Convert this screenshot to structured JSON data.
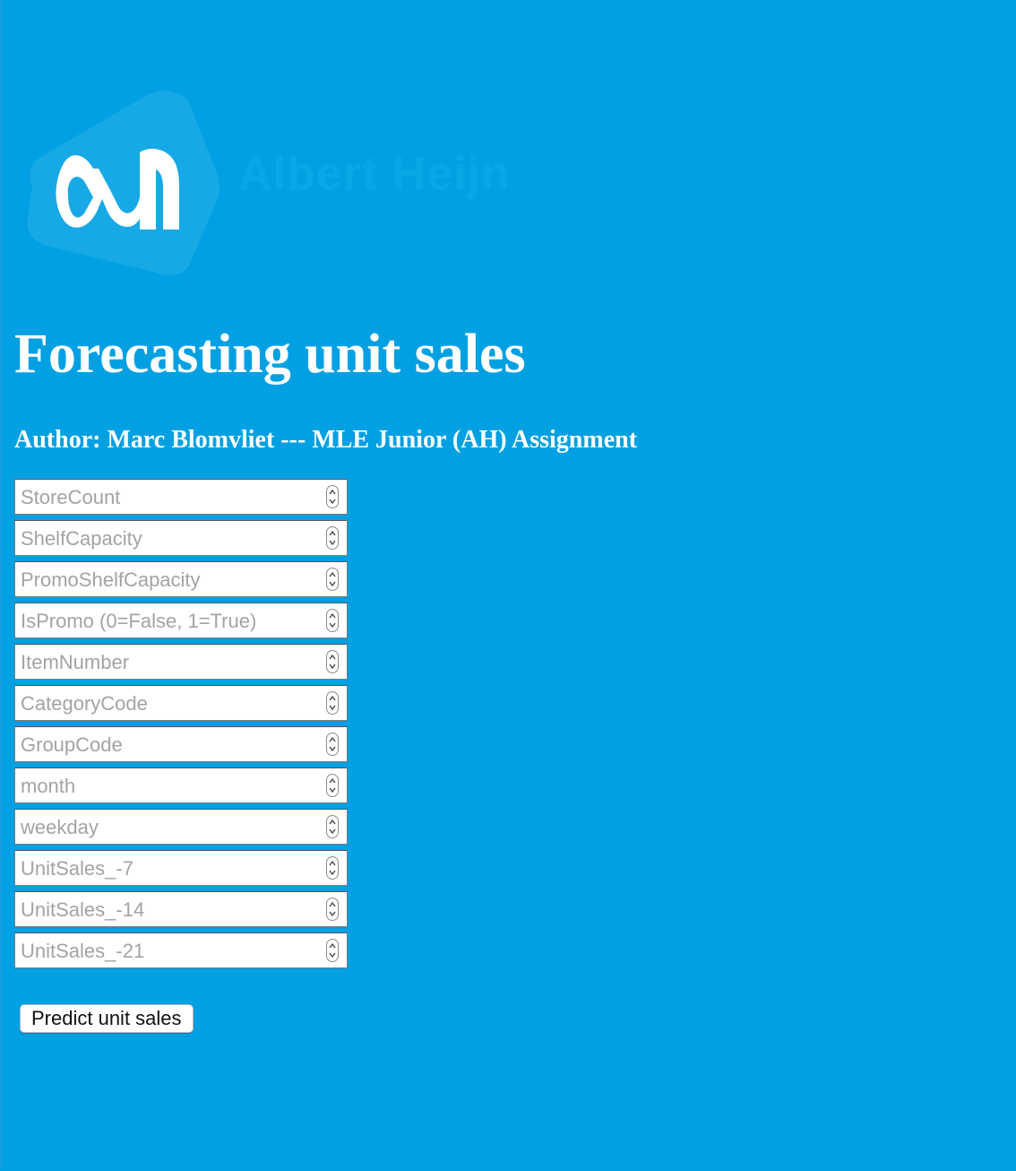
{
  "brand": {
    "logo_text": "Albert Heijn",
    "background_color": "#00a0e2",
    "logo_shape_color": "#16a9e6"
  },
  "header": {
    "title": "Forecasting unit sales",
    "author": "Author: Marc Blomvliet --- MLE Junior (AH) Assignment"
  },
  "form": {
    "fields": [
      {
        "name": "StoreCount",
        "placeholder": "StoreCount",
        "value": ""
      },
      {
        "name": "ShelfCapacity",
        "placeholder": "ShelfCapacity",
        "value": ""
      },
      {
        "name": "PromoShelfCapacity",
        "placeholder": "PromoShelfCapacity",
        "value": ""
      },
      {
        "name": "IsPromo",
        "placeholder": "IsPromo (0=False, 1=True)",
        "value": ""
      },
      {
        "name": "ItemNumber",
        "placeholder": "ItemNumber",
        "value": ""
      },
      {
        "name": "CategoryCode",
        "placeholder": "CategoryCode",
        "value": ""
      },
      {
        "name": "GroupCode",
        "placeholder": "GroupCode",
        "value": ""
      },
      {
        "name": "month",
        "placeholder": "month",
        "value": ""
      },
      {
        "name": "weekday",
        "placeholder": "weekday",
        "value": ""
      },
      {
        "name": "UnitSales_-7",
        "placeholder": "UnitSales_-7",
        "value": ""
      },
      {
        "name": "UnitSales_-14",
        "placeholder": "UnitSales_-14",
        "value": ""
      },
      {
        "name": "UnitSales_-21",
        "placeholder": "UnitSales_-21",
        "value": ""
      }
    ],
    "submit_label": "Predict unit sales",
    "stepper_icon": "up-down-chevron-icon"
  }
}
